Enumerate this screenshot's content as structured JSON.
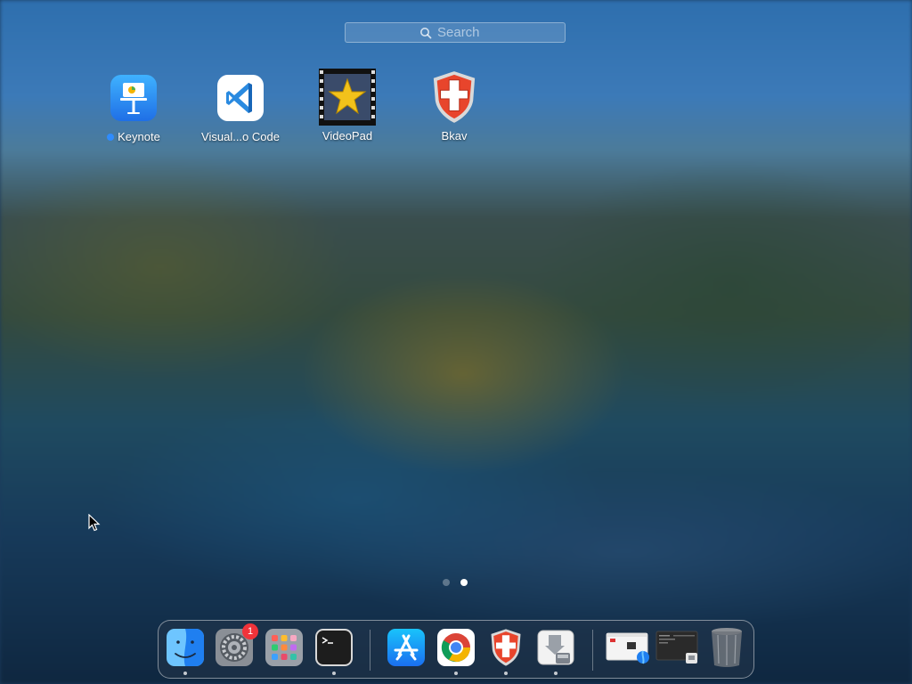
{
  "search": {
    "placeholder": "Search"
  },
  "apps": [
    {
      "label": "Keynote",
      "icon": "keynote-icon",
      "new": true
    },
    {
      "label": "Visual...o Code",
      "icon": "vscode-icon"
    },
    {
      "label": "VideoPad",
      "icon": "videopad-icon"
    },
    {
      "label": "Bkav",
      "icon": "bkav-icon"
    }
  ],
  "pages": {
    "count": 2,
    "current": 2
  },
  "dock": {
    "items": [
      {
        "name": "Finder",
        "icon": "finder-icon",
        "running": true
      },
      {
        "name": "System Preferences",
        "icon": "system-preferences-icon",
        "badge": "1"
      },
      {
        "name": "Launchpad",
        "icon": "launchpad-icon"
      },
      {
        "name": "Terminal",
        "icon": "terminal-icon",
        "running": true
      },
      {
        "name": "App Store",
        "icon": "app-store-icon"
      },
      {
        "name": "Google Chrome",
        "icon": "chrome-icon",
        "running": true
      },
      {
        "name": "Bkav",
        "icon": "bkav-icon",
        "running": true
      },
      {
        "name": "Installer",
        "icon": "installer-icon",
        "running": true
      },
      {
        "name": "Minimized Window 1",
        "icon": "minimized-window-icon"
      },
      {
        "name": "Minimized Window 2",
        "icon": "minimized-window-icon"
      },
      {
        "name": "Trash",
        "icon": "trash-icon"
      }
    ]
  },
  "colors": {
    "accent": "#2f8cff",
    "badge": "#f0333a"
  }
}
